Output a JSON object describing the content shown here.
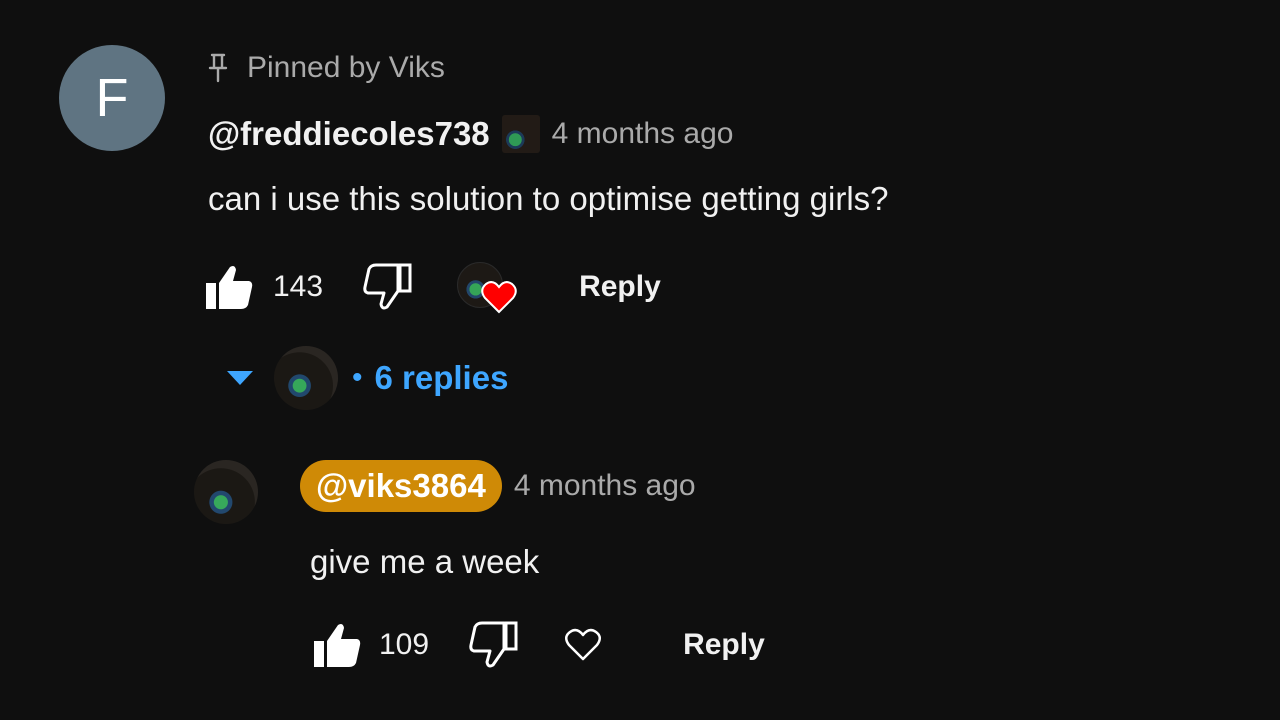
{
  "comment": {
    "avatar_letter": "F",
    "pinned_label": "Pinned by Viks",
    "author": "@freddiecoles738",
    "timestamp": "4 months ago",
    "text": "can i use this solution to optimise getting girls?",
    "like_count": "143",
    "reply_label": "Reply",
    "hearted_by_creator": true
  },
  "replies_toggle": {
    "dot": "•",
    "label": "6 replies",
    "expanded": true
  },
  "reply": {
    "author": "@viks3864",
    "is_creator": true,
    "timestamp": "4 months ago",
    "text": "give me a week",
    "like_count": "109",
    "reply_label": "Reply"
  },
  "colors": {
    "background": "#0f0f0f",
    "text_primary": "#f1f1f1",
    "text_secondary": "#aaaaaa",
    "link_blue": "#3ea6ff",
    "creator_chip": "#cf8a06",
    "heart_red": "#ff0000",
    "letter_avatar": "#5f7482"
  },
  "icons": {
    "pin": "pin-icon",
    "like": "thumbs-up-icon",
    "dislike": "thumbs-down-icon",
    "creator_heart": "heart-icon",
    "toggle": "caret-down-icon"
  }
}
